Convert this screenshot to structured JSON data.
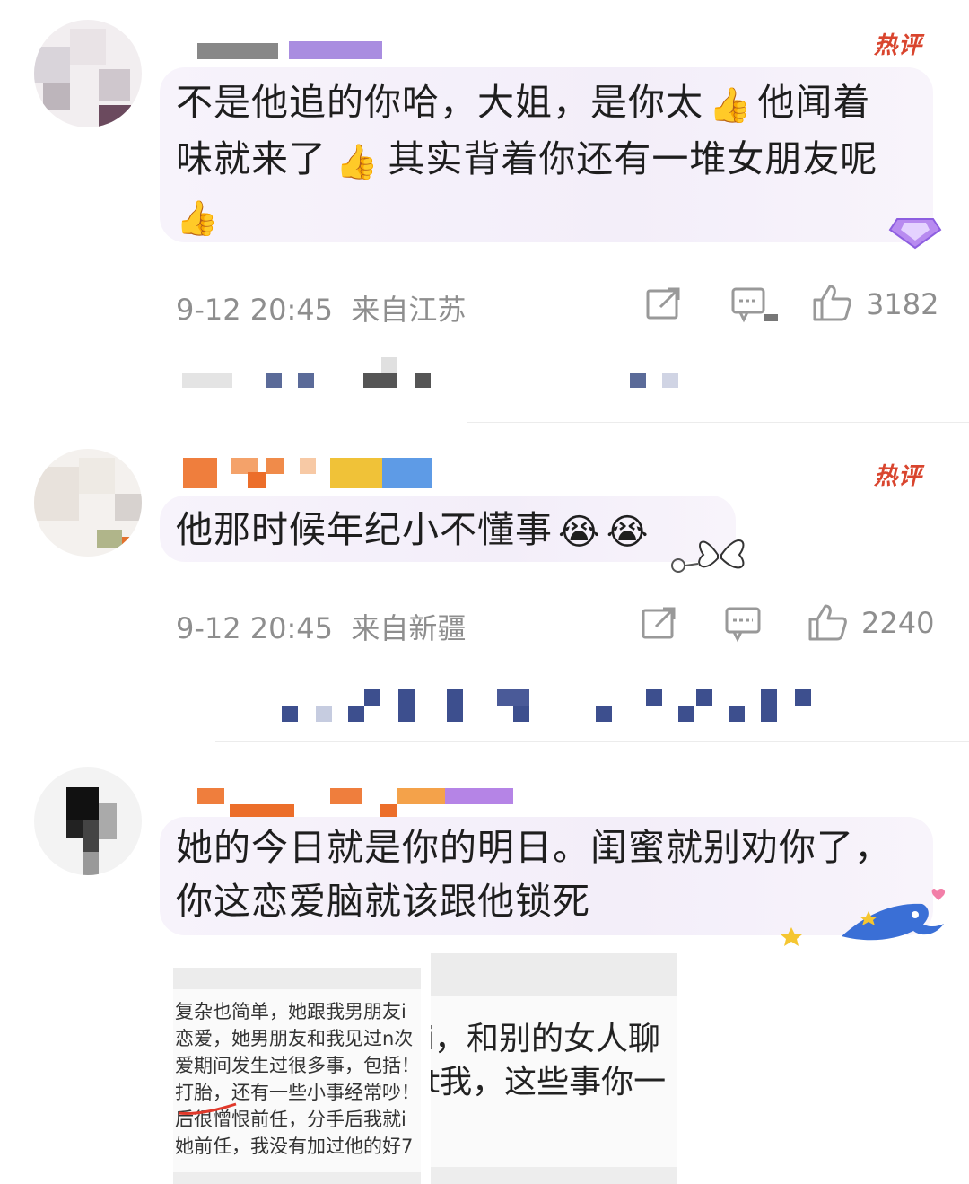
{
  "comments": [
    {
      "hot_badge": "热评",
      "text_line1": "不是他追的你哈，大姐，是你太",
      "text_line1_tail": "他闻着",
      "text_line2_a": "味就来了",
      "text_line2_b": "其实背着你还有一堆女朋友呢",
      "time": "9-12 20:45",
      "location": "来自江苏",
      "likes": "3182",
      "emoji": "thumbs-up-icon"
    },
    {
      "hot_badge": "热评",
      "text": "他那时候年纪小不懂事",
      "time": "9-12 20:45",
      "location": "来自新疆",
      "likes": "2240",
      "emoji": "crying-face-icon"
    },
    {
      "text_line1": "她的今日就是你的明日。闺蜜就别劝你了，",
      "text_line2": "你这恋爱脑就该跟他锁死"
    }
  ],
  "attached_screenshot_left": [
    "复杂也简单，她跟我男朋友i",
    "恋爱，她男朋友和我见过n次",
    "爱期间发生过很多事，包括！",
    "打胎，还有一些小事经常吵！",
    "后很憎恨前任，分手后我就i",
    "她前任，我没有加过他的好7"
  ],
  "attached_screenshot_right": [
    "i，和别的女人聊",
    "t我，这些事你一"
  ],
  "colors": {
    "hot": "#d9452e",
    "meta": "#8e8e8e",
    "bubble": "#f4eff9"
  }
}
